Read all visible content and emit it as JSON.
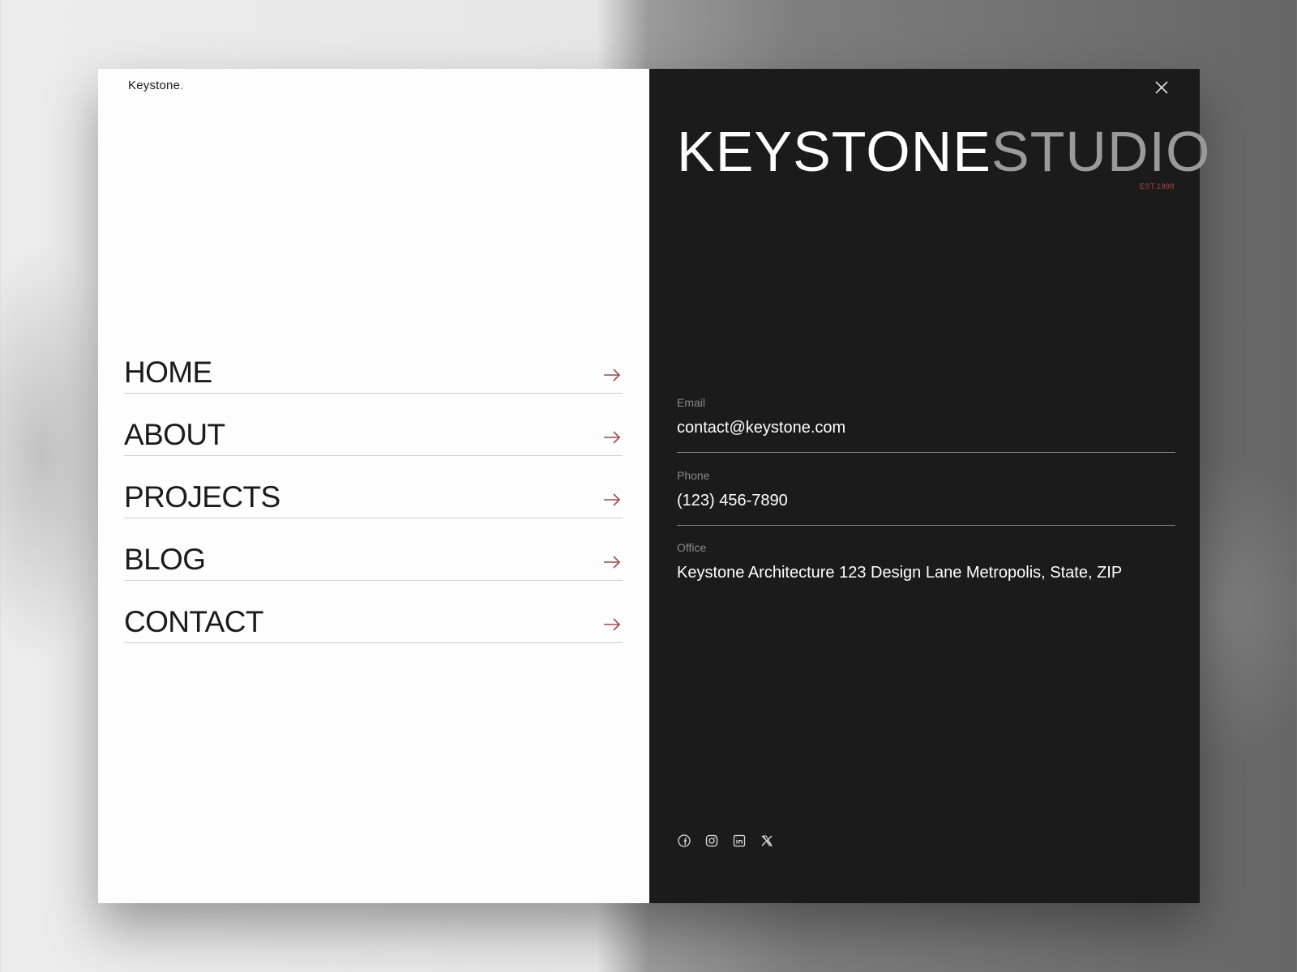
{
  "logo": {
    "text": "Keystone",
    "dot": "."
  },
  "nav": [
    {
      "label": "HOME"
    },
    {
      "label": "ABOUT"
    },
    {
      "label": "PROJECTS"
    },
    {
      "label": "BLOG"
    },
    {
      "label": "CONTACT"
    }
  ],
  "brand": {
    "part1": "KEYSTONE",
    "part2": "STUDIO",
    "est": "EST.1998"
  },
  "contact": {
    "email_label": "Email",
    "email_value": "contact@keystone.com",
    "phone_label": "Phone",
    "phone_value": "(123) 456-7890",
    "office_label": "Office",
    "office_value": "Keystone Architecture 123 Design Lane Metropolis, State, ZIP"
  },
  "social": [
    "facebook-icon",
    "instagram-icon",
    "linkedin-icon",
    "x-icon"
  ],
  "colors": {
    "accent": "#9a4a4a",
    "dark_panel": "#1b1b1b",
    "light_panel": "#fdfdfd"
  }
}
